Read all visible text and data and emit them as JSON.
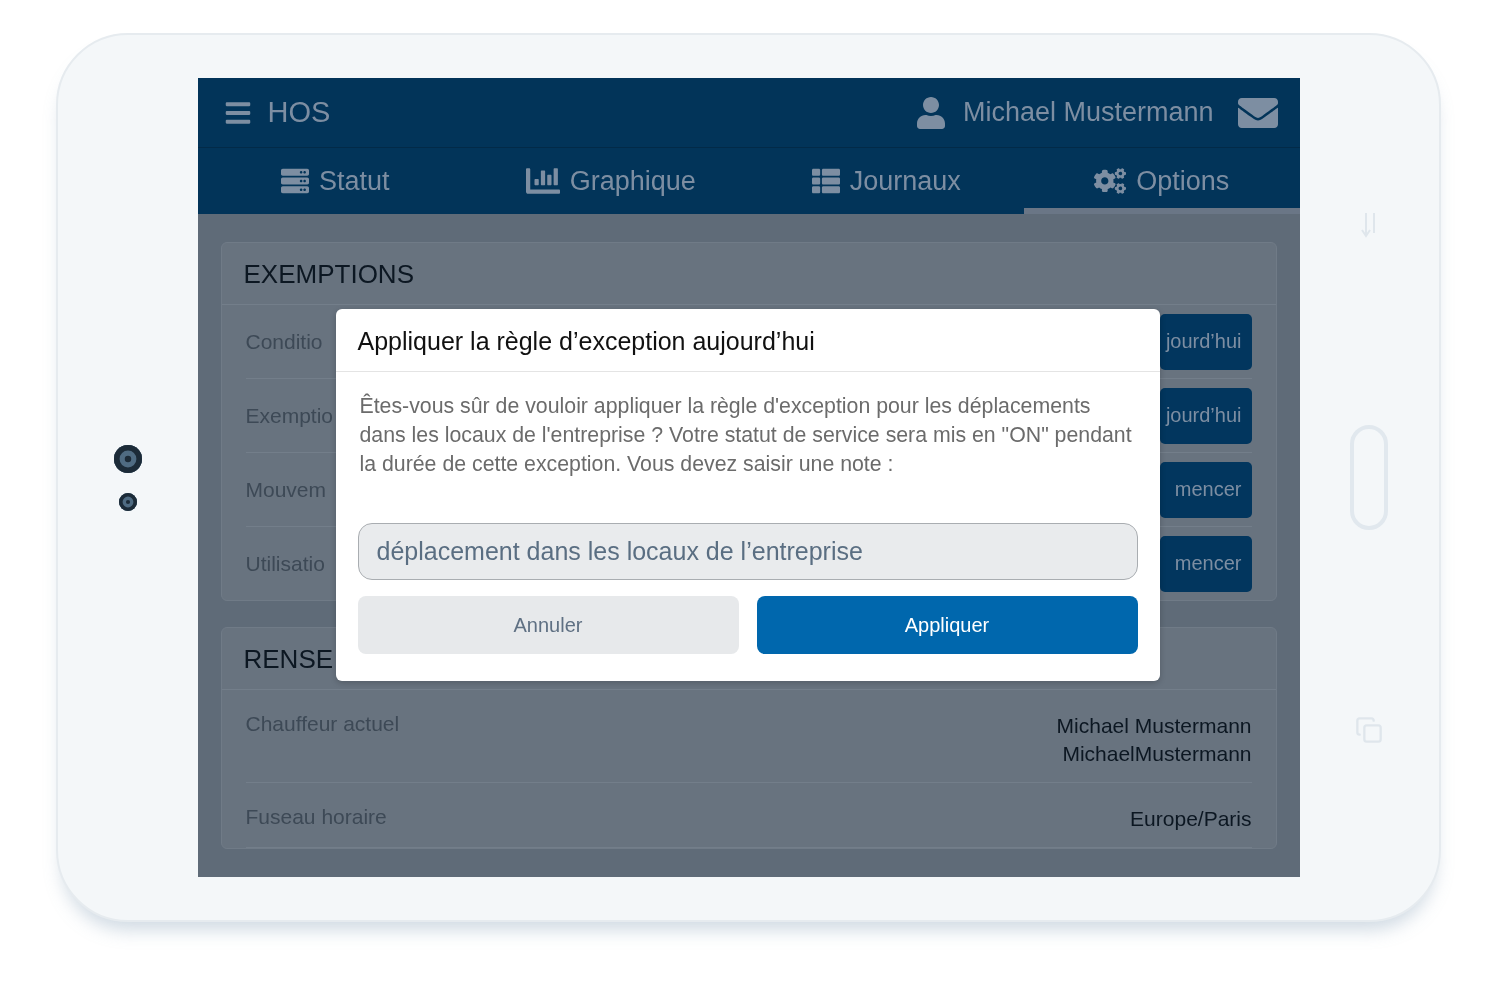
{
  "header": {
    "title": "HOS",
    "user": "Michael Mustermann"
  },
  "tabs": [
    {
      "label": "Statut",
      "kind": "status",
      "selected": false
    },
    {
      "label": "Graphique",
      "kind": "chart",
      "selected": false
    },
    {
      "label": "Journaux",
      "kind": "list",
      "selected": false
    },
    {
      "label": "Options",
      "kind": "settings",
      "selected": true
    }
  ],
  "exemptions": {
    "title": "EXEMPTIONS",
    "rows": [
      {
        "label": "Conditio",
        "button": "jourd’hui"
      },
      {
        "label": "Exemptio",
        "button": "jourd’hui"
      },
      {
        "label": "Mouvem",
        "button": "mencer"
      },
      {
        "label": "Utilisatio",
        "button": "mencer"
      }
    ]
  },
  "info": {
    "title": "RENSE",
    "rows": [
      {
        "label": "Chauffeur actuel",
        "value": [
          "Michael Mustermann",
          "MichaelMustermann"
        ]
      },
      {
        "label": "Fuseau horaire",
        "value": [
          "Europe/Paris"
        ]
      }
    ]
  },
  "dialog": {
    "title": "Appliquer la règle d’exception aujourd’hui",
    "message": "Êtes-vous sûr de vouloir appliquer la règle d'exception pour les déplacements dans les locaux de l'entreprise ? Votre statut de service sera mis en \"ON\" pendant la durée de cette exception. Vous devez saisir une note :",
    "note_value": "déplacement dans les locaux de l’entreprise",
    "buttons": [
      {
        "label": "Annuler",
        "kind": "secondary"
      },
      {
        "label": "Appliquer",
        "kind": "primary"
      }
    ]
  }
}
